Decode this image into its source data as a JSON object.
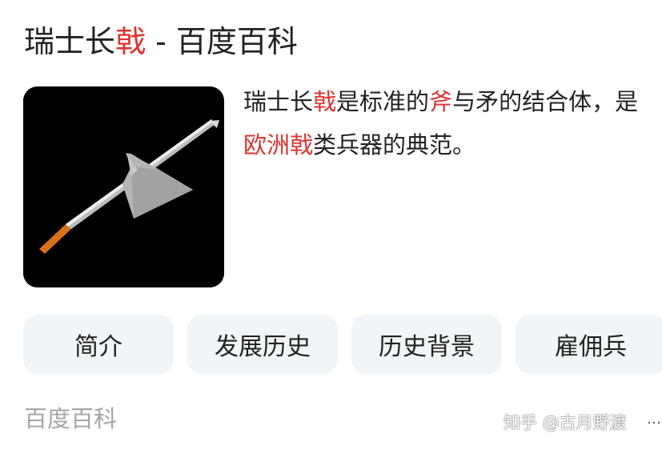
{
  "card": {
    "title_term": "瑞士长",
    "title_highlight": "戟",
    "title_suffix": " - 百度百科",
    "image_subject": "halberd",
    "description": {
      "p1": "瑞士长",
      "p2": "戟",
      "p3": "是标准的",
      "p4": "斧",
      "p5": "与矛的结合体，是",
      "p6": "欧洲",
      "p7": "戟",
      "p8": "类兵器的典范。"
    },
    "tabs": [
      "简介",
      "发展历史",
      "历史背景",
      "雇佣兵"
    ],
    "source": "百度百科"
  },
  "watermark": "知乎 @古月野渡",
  "more_icon": "…",
  "colors": {
    "highlight": "#e0322e",
    "text": "#222222",
    "tab_bg": "#f3f4f7",
    "source_text": "#a6a6a6"
  }
}
